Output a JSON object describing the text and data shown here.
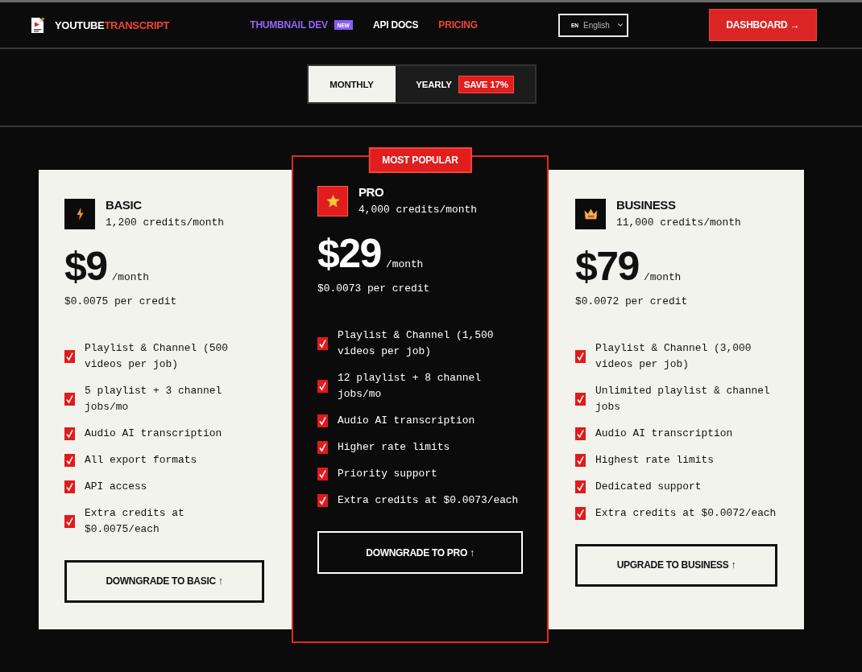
{
  "header": {
    "logo": {
      "part_1": "YOUTUBE",
      "part_2": "TRANSCRIPT"
    },
    "nav": [
      {
        "label": "THUMBNAIL DEV",
        "kind": "highlight",
        "badge": "NEW",
        "selected": false
      },
      {
        "label": "API DOCS",
        "kind": "link",
        "selected": false
      },
      {
        "label": "PRICING",
        "kind": "link",
        "selected": true
      }
    ],
    "language": {
      "code": "EN",
      "value": "English"
    },
    "dashboard_button": "DASHBOARD →"
  },
  "billing_toggle": [
    {
      "label": "MONTHLY",
      "selected": true
    },
    {
      "label": "YEARLY",
      "selected": false,
      "badge": "SAVE 17%"
    }
  ],
  "plans": [
    {
      "name": "BASIC",
      "credits": "1,200 credits/month",
      "price": "$9",
      "period": "/month",
      "per_credit": "$0.0075 per credit",
      "featured": false,
      "features": [
        "Playlist & Channel (500 videos per job)",
        "5 playlist + 3 channel jobs/mo",
        "Audio AI transcription",
        "All export formats",
        "API access",
        "Extra credits at $0.0075/each"
      ],
      "button": "DOWNGRADE TO BASIC ↑"
    },
    {
      "name": "PRO",
      "credits": "4,000 credits/month",
      "price": "$29",
      "period": "/month",
      "per_credit": "$0.0073 per credit",
      "featured": true,
      "ribbon": "MOST POPULAR",
      "features": [
        "Playlist & Channel (1,500 videos per job)",
        "12 playlist + 8 channel jobs/mo",
        "Audio AI transcription",
        "Higher rate limits",
        "Priority support",
        "Extra credits at $0.0073/each"
      ],
      "button": "DOWNGRADE TO PRO ↑"
    },
    {
      "name": "BUSINESS",
      "credits": "11,000 credits/month",
      "price": "$79",
      "period": "/month",
      "per_credit": "$0.0072 per credit",
      "featured": false,
      "features": [
        "Playlist & Channel (3,000 videos per job)",
        "Unlimited playlist & channel jobs",
        "Audio AI transcription",
        "Highest rate limits",
        "Dedicated support",
        "Extra credits at $0.0072/each"
      ],
      "button": "UPGRADE TO BUSINESS ↑"
    }
  ]
}
